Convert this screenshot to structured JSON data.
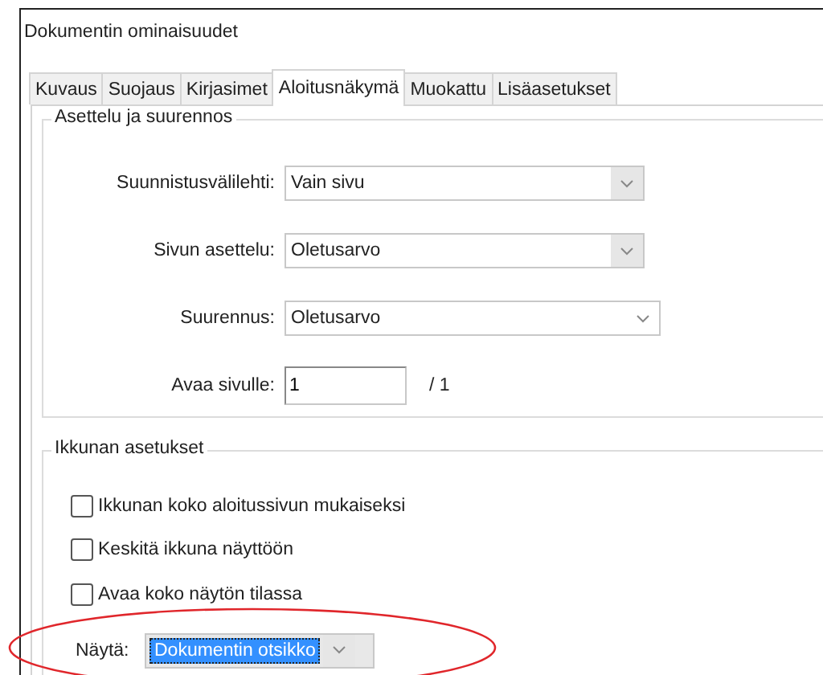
{
  "window": {
    "title": "Dokumentin ominaisuudet"
  },
  "tabs": [
    {
      "label": "Kuvaus",
      "selected": false
    },
    {
      "label": "Suojaus",
      "selected": false
    },
    {
      "label": "Kirjasimet",
      "selected": false
    },
    {
      "label": "Aloitusnäkymä",
      "selected": true
    },
    {
      "label": "Muokattu",
      "selected": false
    },
    {
      "label": "Lisäasetukset",
      "selected": false
    }
  ],
  "layout_group": {
    "title": "Asettelu ja suurennos",
    "rows": [
      {
        "kind": "list",
        "label": "Suunnistusvälilehti:",
        "value": "Vain sivu"
      },
      {
        "kind": "list",
        "label": "Sivun asettelu:",
        "value": "Oletusarvo"
      },
      {
        "kind": "combo",
        "label": "Suurennus:",
        "value": "Oletusarvo"
      },
      {
        "kind": "page",
        "label": "Avaa sivulle:",
        "value": "1",
        "suffix": "/ 1"
      }
    ]
  },
  "window_group": {
    "title": "Ikkunan asetukset",
    "checkboxes": [
      {
        "label": "Ikkunan koko aloitussivun mukaiseksi",
        "checked": false
      },
      {
        "label": "Keskitä ikkuna näyttöön",
        "checked": false
      },
      {
        "label": "Avaa koko näytön tilassa",
        "checked": false
      }
    ],
    "show": {
      "label": "Näytä:",
      "value": "Dokumentin otsikko",
      "focused": true
    }
  },
  "annotation": {
    "kind": "ellipse",
    "color": "#e0262b"
  }
}
